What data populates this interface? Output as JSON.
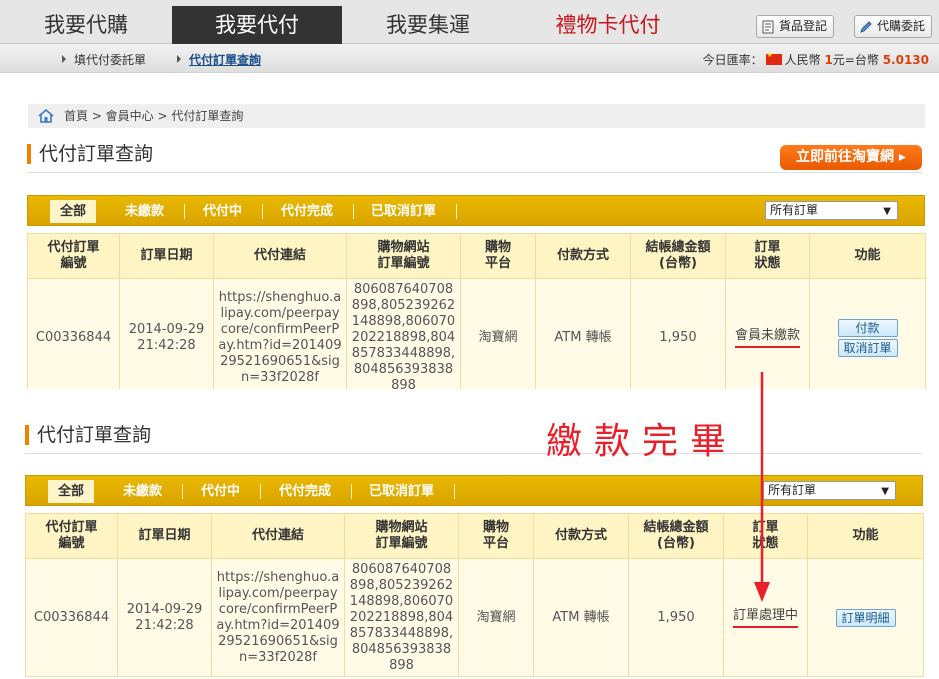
{
  "nav": {
    "tabs": [
      {
        "label": "我要代購"
      },
      {
        "label": "我要代付"
      },
      {
        "label": "我要集運"
      },
      {
        "label": "禮物卡代付"
      }
    ],
    "register_label": "貨品登記",
    "commission_label": "代購委託"
  },
  "subnav": {
    "items": [
      {
        "label": "填代付委託單"
      },
      {
        "label": "代付訂單查詢"
      }
    ],
    "rate": {
      "prefix": "今日匯率：",
      "currency": "人民幣",
      "cny_amount": "1",
      "mid": "元=台幣",
      "twd_amount": "5.0130"
    }
  },
  "breadcrumb": "首頁 > 會員中心 > 代付訂單查詢",
  "page_title": "代付訂單查詢",
  "taobao_button": "立即前往淘寶網 ▸",
  "filters": [
    "全部",
    "未繳款",
    "代付中",
    "代付完成",
    "已取消訂單"
  ],
  "order_select": {
    "value": "所有訂單"
  },
  "table": {
    "headers": [
      "代付訂單編號",
      "訂單日期",
      "代付連結",
      "購物網站訂單編號",
      "購物平台",
      "付款方式",
      "結帳總金額(台幣)",
      "訂單狀態",
      "功能"
    ],
    "header_lines": [
      [
        "代付訂單",
        "編號"
      ],
      [
        "訂單日期"
      ],
      [
        "代付連結"
      ],
      [
        "購物網站",
        "訂單編號"
      ],
      [
        "購物",
        "平台"
      ],
      [
        "付款方式"
      ],
      [
        "結帳總金額",
        "(台幣)"
      ],
      [
        "訂單",
        "狀態"
      ],
      [
        "功能"
      ]
    ],
    "row": {
      "order_id": "C00336844",
      "date": "2014-09-29 21:42:28",
      "link": "https://shenghuo.alipay.com/peerpaycore/confirmPeerPay.htm?id=20140929521690651&sign=33f2028f",
      "site_order_no": "806087640708898,805239262148898,806070202218898,804857833448898,804856393838898",
      "platform": "淘寶網",
      "payment": "ATM 轉帳",
      "total": "1,950"
    }
  },
  "before": {
    "status": "會員未繳款",
    "actions": [
      "付款",
      "取消訂單"
    ]
  },
  "after": {
    "status": "訂單處理中",
    "actions": [
      "訂單明細"
    ]
  },
  "annotation": "繳款完畢",
  "colors": {
    "accent": "#f08200",
    "filter_bar": "#e0ad00",
    "status_underline": "#e0202a",
    "annotation": "#e8202a"
  }
}
